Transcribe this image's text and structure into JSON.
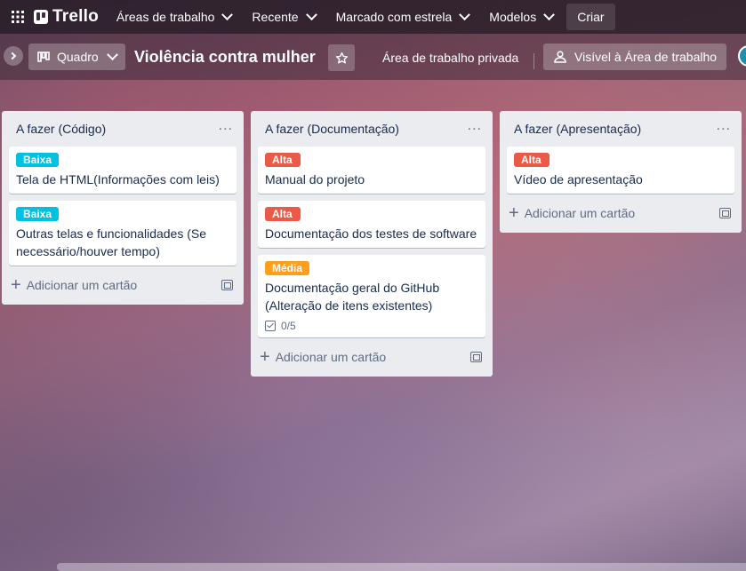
{
  "nav": {
    "brand": "Trello",
    "items": [
      {
        "label": "Áreas de trabalho"
      },
      {
        "label": "Recente"
      },
      {
        "label": "Marcado com estrela"
      },
      {
        "label": "Modelos"
      }
    ],
    "create_label": "Criar"
  },
  "board": {
    "view_label": "Quadro",
    "title": "Violência contra mulher",
    "workspace_label": "Área de trabalho privada",
    "visibility_label": "Visível à Área de trabalho"
  },
  "colors": {
    "baixa": "#00c2e0",
    "alta": "#eb5a46",
    "media": "#ff9f1a"
  },
  "lists": [
    {
      "title": "A fazer (Código)",
      "add_card_label": "Adicionar um cartão",
      "cards": [
        {
          "label": "Baixa",
          "title": "Tela de HTML(Informações com leis)"
        },
        {
          "label": "Baixa",
          "title": "Outras telas e funcionalidades (Se necessário/houver tempo)"
        }
      ]
    },
    {
      "title": "A fazer (Documentação)",
      "add_card_label": "Adicionar um cartão",
      "cards": [
        {
          "label": "Alta",
          "title": "Manual do projeto"
        },
        {
          "label": "Alta",
          "title": "Documentação dos testes de software"
        },
        {
          "label": "Média",
          "title": "Documentação geral do GitHub (Alteração de itens existentes)",
          "checklist": "0/5"
        }
      ]
    },
    {
      "title": "A fazer (Apresentação)",
      "add_card_label": "Adicionar um cartão",
      "cards": [
        {
          "label": "Alta",
          "title": "Vídeo de apresentação"
        }
      ]
    }
  ]
}
